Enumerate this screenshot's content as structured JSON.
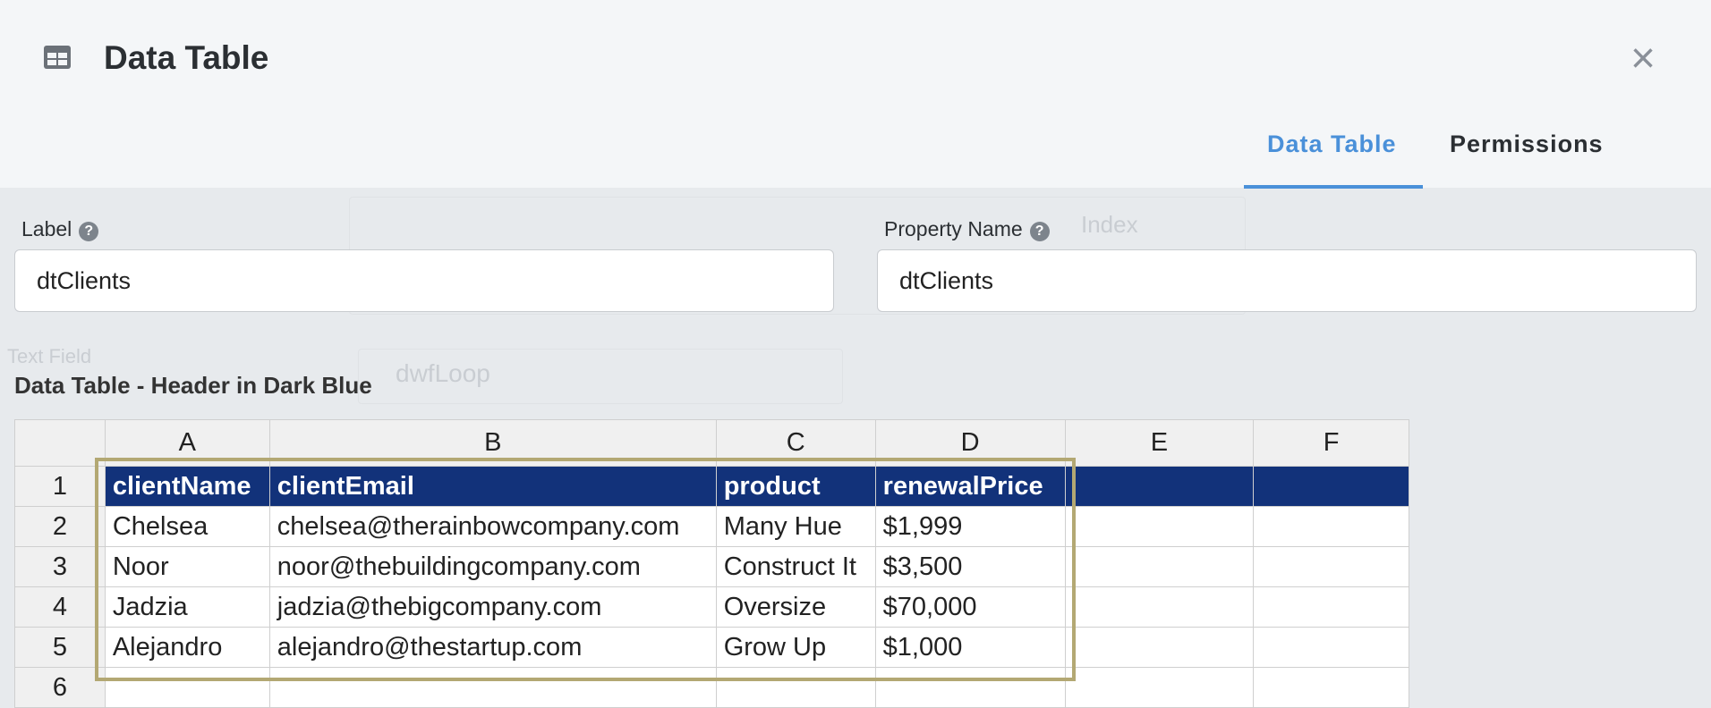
{
  "modal": {
    "title": "Data Table",
    "close_symbol": "×",
    "tabs": [
      {
        "label": "Data Table",
        "active": true
      },
      {
        "label": "Permissions",
        "active": false
      }
    ]
  },
  "fields": {
    "label": {
      "label": "Label",
      "value": "dtClients"
    },
    "property_name": {
      "label": "Property Name",
      "value": "dtClients"
    }
  },
  "background": {
    "text_field": "Text Field",
    "loop": "dwfLoop",
    "index": "Index"
  },
  "table": {
    "title": "Data Table - Header in Dark Blue",
    "header_color": "#12327a",
    "columns": [
      "A",
      "B",
      "C",
      "D",
      "E",
      "F"
    ],
    "rows": [
      {
        "num": "1",
        "cells": [
          "clientName",
          "clientEmail",
          "product",
          "renewalPrice",
          "",
          ""
        ]
      },
      {
        "num": "2",
        "cells": [
          "Chelsea",
          "chelsea@therainbowcompany.com",
          "Many Hue",
          "$1,999",
          "",
          ""
        ]
      },
      {
        "num": "3",
        "cells": [
          "Noor",
          "noor@thebuildingcompany.com",
          "Construct It",
          "$3,500",
          "",
          ""
        ]
      },
      {
        "num": "4",
        "cells": [
          "Jadzia",
          "jadzia@thebigcompany.com",
          "Oversize",
          "$70,000",
          "",
          ""
        ]
      },
      {
        "num": "5",
        "cells": [
          "Alejandro",
          "alejandro@thestartup.com",
          "Grow Up",
          "$1,000",
          "",
          ""
        ]
      },
      {
        "num": "6",
        "cells": [
          "",
          "",
          "",
          "",
          "",
          ""
        ]
      }
    ]
  }
}
